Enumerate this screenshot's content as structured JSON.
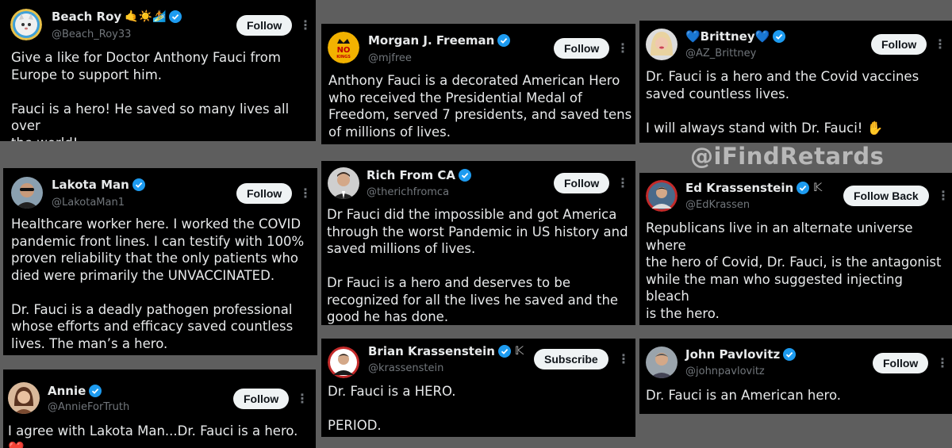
{
  "watermark": "@iFindRetards",
  "colors": {
    "verified": "#1d9bf0",
    "background": "#5e5e5e",
    "card": "#000000"
  },
  "cards": {
    "beach_roy": {
      "name": "Beach Roy",
      "name_emoji": "🤙☀️🏄",
      "handle": "@Beach_Roy33",
      "button": "Follow",
      "text": "Give a like for Doctor Anthony Fauci from\nEurope to support him.\n\nFauci is a hero! He saved so many lives all over\nthe world!"
    },
    "lakota_man": {
      "name": "Lakota Man",
      "handle": "@LakotaMan1",
      "button": "Follow",
      "text": "Healthcare worker here. I worked the COVID\npandemic front lines. I can testify with 100%\nproven reliability that the only patients who\ndied were primarily the UNVACCINATED.\n\nDr. Fauci is a deadly pathogen professional\nwhose efforts and efficacy saved countless\nlives. The man’s a hero."
    },
    "annie": {
      "name": "Annie",
      "handle": "@AnnieForTruth",
      "button": "Follow",
      "text": "I agree with Lakota Man...Dr. Fauci is a hero. ❤️"
    },
    "morgan": {
      "name": "Morgan J. Freeman",
      "handle": "@mjfree",
      "button": "Follow",
      "avatar_text": "NO KINGS",
      "text": "Anthony Fauci is a decorated American Hero\nwho received the Presidential Medal of\nFreedom, served 7 presidents, and saved tens\nof millions of lives."
    },
    "rich": {
      "name": "Rich From CA",
      "handle": "@therichfromca",
      "button": "Follow",
      "text": "Dr Fauci did the impossible and got America\nthrough the worst Pandemic in US history and\nsaved millions of lives.\n\nDr Fauci is a hero and deserves to be\nrecognized for all the lives he saved and the\ngood he has done."
    },
    "brian": {
      "name": "Brian Krassenstein",
      "handle": "@krassenstein",
      "button": "Subscribe",
      "text": "Dr. Fauci is a HERO.\n\nPERIOD."
    },
    "brittney": {
      "name": "💙Brittney💙",
      "handle": "@AZ_Brittney",
      "button": "Follow",
      "text": "Dr. Fauci is a hero and the Covid vaccines\nsaved countless lives.\n\nI will always stand with Dr. Fauci! ✋"
    },
    "ed": {
      "name": "Ed Krassenstein",
      "handle": "@EdKrassen",
      "button": "Follow Back",
      "text": "Republicans live in an alternate universe where\nthe hero of Covid, Dr. Fauci, is the antagonist\nwhile the man who suggested injecting bleach\nis the hero.\n\nThat’s what cults do."
    },
    "john": {
      "name": "John Pavlovitz",
      "handle": "@johnpavlovitz",
      "button": "Follow",
      "text": "Dr. Fauci is an American hero."
    }
  }
}
